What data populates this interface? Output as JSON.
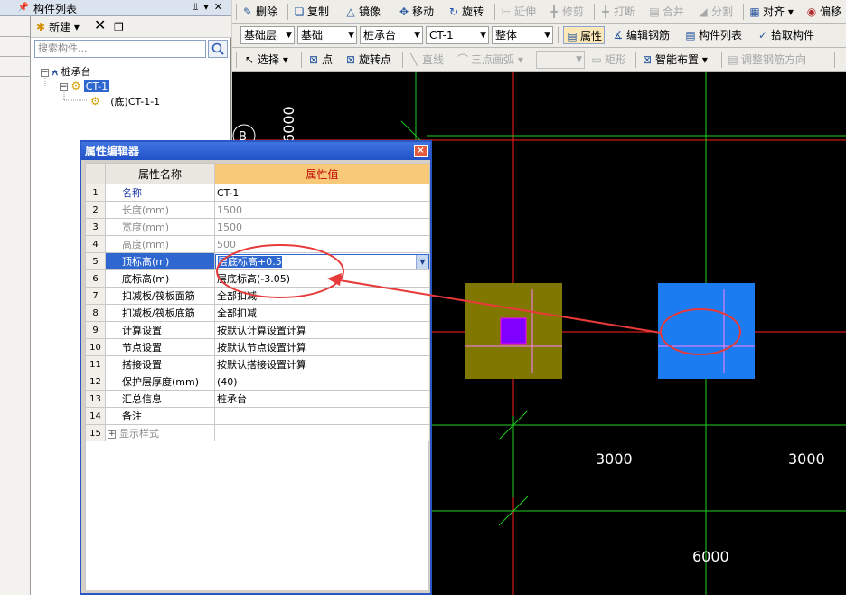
{
  "left_strip": {
    "pin": "p"
  },
  "component_panel": {
    "title": "构件列表",
    "title_buttons": "p ▾ ×",
    "new_label": "新建",
    "search_placeholder": "搜索构件...",
    "tree": {
      "root_label": "桩承台",
      "child_label": "CT-1",
      "grandchild_label": "(底)CT-1-1"
    }
  },
  "toolbar1": {
    "delete": "删除",
    "copy": "复制",
    "mirror": "镜像",
    "move": "移动",
    "rotate": "旋转",
    "extend": "延伸",
    "trim": "修剪",
    "break": "打断",
    "merge": "合并",
    "split": "分割",
    "align": "对齐",
    "offset": "偏移"
  },
  "toolbar2": {
    "layer": "基础层",
    "type": "基础",
    "category": "桩承台",
    "component": "CT-1",
    "whole": "整体",
    "property": "属性",
    "edit_rebar": "编辑钢筋",
    "component_list": "构件列表",
    "pick": "拾取构件"
  },
  "toolbar3": {
    "select": "选择",
    "point": "点",
    "rotate_point": "旋转点",
    "line": "直线",
    "arc3": "三点画弧",
    "rect": "矩形",
    "smart_layout": "智能布置",
    "adjust_rebar": "调整钢筋方向"
  },
  "canvas": {
    "axis_label": "B",
    "top_dim": "6000",
    "dim_left": "3000",
    "dim_right": "3000",
    "dim_total": "6000",
    "colors": {
      "grid_red": "#ff2020",
      "grid_green": "#1fd01f",
      "cap_left": "#7f7700",
      "cap_right": "#1a7cf0",
      "pile": "#7f00ff",
      "annotation": "#e83a3a"
    }
  },
  "property_editor": {
    "title": "属性编辑器",
    "close": "×",
    "header_name": "属性名称",
    "header_value": "属性值",
    "rows": [
      {
        "no": "1",
        "name": "名称",
        "value": "CT-1"
      },
      {
        "no": "2",
        "name": "长度(mm)",
        "value": "1500"
      },
      {
        "no": "3",
        "name": "宽度(mm)",
        "value": "1500"
      },
      {
        "no": "4",
        "name": "高度(mm)",
        "value": "500"
      },
      {
        "no": "5",
        "name": "顶标高(m)",
        "value": "层底标高+0.5"
      },
      {
        "no": "6",
        "name": "底标高(m)",
        "value": "层底标高(-3.05)"
      },
      {
        "no": "7",
        "name": "扣减板/筏板面筋",
        "value": "全部扣减"
      },
      {
        "no": "8",
        "name": "扣减板/筏板底筋",
        "value": "全部扣减"
      },
      {
        "no": "9",
        "name": "计算设置",
        "value": "按默认计算设置计算"
      },
      {
        "no": "10",
        "name": "节点设置",
        "value": "按默认节点设置计算"
      },
      {
        "no": "11",
        "name": "搭接设置",
        "value": "按默认搭接设置计算"
      },
      {
        "no": "12",
        "name": "保护层厚度(mm)",
        "value": "(40)"
      },
      {
        "no": "13",
        "name": "汇总信息",
        "value": "桩承台"
      },
      {
        "no": "14",
        "name": "备注",
        "value": ""
      },
      {
        "no": "15",
        "name": "显示样式",
        "value": ""
      }
    ]
  }
}
